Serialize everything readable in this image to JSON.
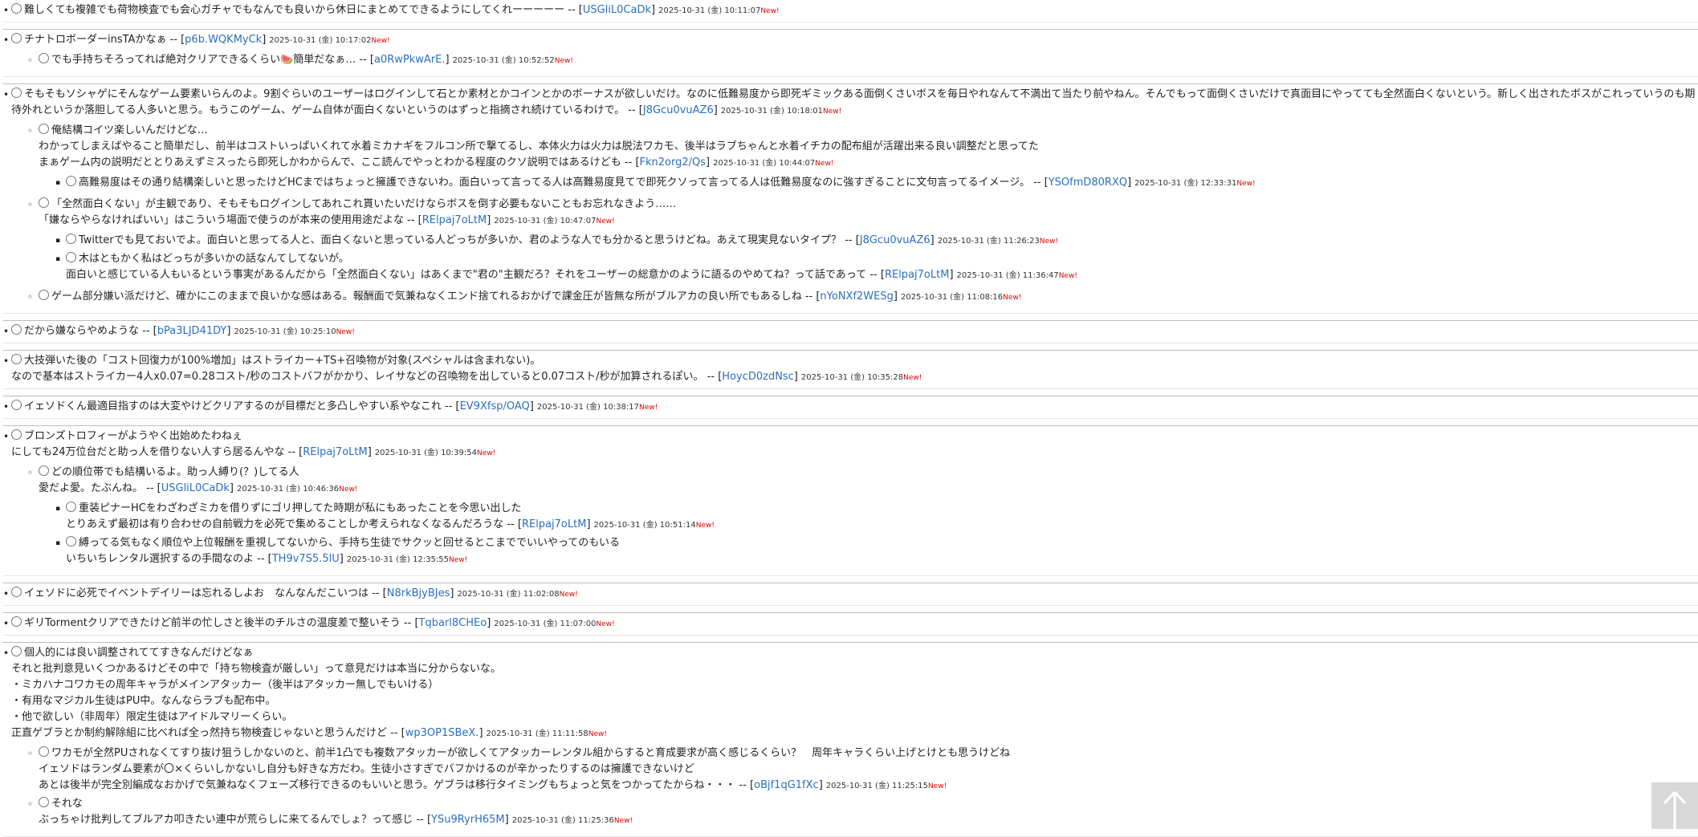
{
  "new_label": "New!",
  "posts": [
    {
      "text": "難しくても複雑でも荷物検査でも会心ガチャでもなんでも良いから休日にまとめてできるようにしてくれーーーーー",
      "id": "USGliL0CaDk",
      "date": "2025-10-31 (金) 10:11:07",
      "replies": []
    },
    {
      "text": "チナトロボーダーinsTAかなぁ",
      "id": "p6b.WQKMyCk",
      "date": "2025-10-31 (金) 10:17:02",
      "replies": [
        {
          "text": "でも手持ちそろってれば絶対クリアできるくらい🍉簡単だなぁ…",
          "id": "a0RwPkwArE.",
          "date": "2025-10-31 (金) 10:52:52",
          "replies": []
        }
      ]
    },
    {
      "text": "そもそもソシャゲにそんなゲーム要素いらんのよ。9割ぐらいのユーザーはログインして石とか素材とかコインとかのボーナスが欲しいだけ。なのに低難易度から即死ギミックある面倒くさいボスを毎日やれなんて不満出て当たり前やねん。そんでもって面倒くさいだけで真面目にやってても全然面白くないという。新しく出されたボスがこれっていうのも期待外れというか落胆してる人多いと思う。もうこのゲーム、ゲーム自体が面白くないというのはずっと指摘され続けているわけで。",
      "id": "J8Gcu0vuAZ6",
      "date": "2025-10-31 (金) 10:18:01",
      "replies": [
        {
          "text": "俺結構コイツ楽しいんだけどな…\nわかってしまえばやること簡単だし、前半はコストいっぱいくれて水着ミカナギをフルコン所で撃てるし、本体火力は火力は脱法ワカモ、後半はラブちゃんと水着イチカの配布組が活躍出来る良い調整だと思ってた\nまぁゲーム内の説明だととりあえずミスったら即死しかわからんで、ここ読んでやっとわかる程度のクソ説明ではあるけども",
          "id": "Fkn2org2/Qs",
          "date": "2025-10-31 (金) 10:44:07",
          "replies": [
            {
              "text": "高難易度はその通り結構楽しいと思ったけどHCまではちょっと擁護できないわ。面白いって言ってる人は高難易度見てで即死クソって言ってる人は低難易度なのに強すぎることに文句言ってるイメージ。",
              "id": "YSOfmD80RXQ",
              "date": "2025-10-31 (金) 12:33:31",
              "replies": []
            }
          ]
        },
        {
          "text": "「全然面白くない」が主観であり、そもそもログインしてあれこれ貰いたいだけならボスを倒す必要もないこともお忘れなきよう……\n「嫌ならやらなければいい」はこういう場面で使うのが本来の使用用途だよな",
          "id": "RElpaj7oLtM",
          "date": "2025-10-31 (金) 10:47:07",
          "replies": [
            {
              "text": "Twitterでも見ておいでよ。面白いと思ってる人と、面白くないと思っている人どっちが多いか、君のような人でも分かると思うけどね。あえて現実見ないタイプ？",
              "id": "J8Gcu0vuAZ6",
              "date": "2025-10-31 (金) 11:26:23",
              "replies": []
            },
            {
              "text": "木はともかく私はどっちが多いかの話なんてしてないが。\n面白いと感じている人もいるという事実があるんだから「全然面白くない」はあくまで\"君の\"主観だろ？それをユーザーの総意かのように語るのやめてね？って話であって",
              "id": "RElpaj7oLtM",
              "date": "2025-10-31 (金) 11:36:47",
              "replies": []
            }
          ]
        },
        {
          "text": "ゲーム部分嫌い派だけど、確かにこのままで良いかな感はある。報酬面で気兼ねなくエンド捨てれるおかげで課金圧が皆無な所がブルアカの良い所でもあるしね",
          "id": "nYoNXf2WESg",
          "date": "2025-10-31 (金) 11:08:16",
          "replies": []
        }
      ]
    },
    {
      "text": "だから嫌ならやめような",
      "id": "bPa3LJD41DY",
      "date": "2025-10-31 (金) 10:25:10",
      "replies": []
    },
    {
      "text": "大技弾いた後の「コスト回復力が100%増加」はストライカー+TS+召喚物が対象(スペシャルは含まれない)。\nなので基本はストライカー4人x0.07=0.28コスト/秒のコストバフがかかり、レイサなどの召喚物を出していると0.07コスト/秒が加算されるぽい。",
      "id": "HoycD0zdNsc",
      "date": "2025-10-31 (金) 10:35:28",
      "replies": []
    },
    {
      "text": "イェソドくん最適目指すのは大変やけどクリアするのが目標だと多凸しやすい系やなこれ",
      "id": "EV9Xfsp/OAQ",
      "date": "2025-10-31 (金) 10:38:17",
      "replies": []
    },
    {
      "text": "ブロンズトロフィーがようやく出始めたわねぇ\nにしても24万位台だと助っ人を借りない人すら居るんやな",
      "id": "RElpaj7oLtM",
      "date": "2025-10-31 (金) 10:39:54",
      "replies": [
        {
          "text": "どの順位帯でも結構いるよ。助っ人縛り(？)してる人\n愛だよ愛。たぶんね。",
          "id": "USGliL0CaDk",
          "date": "2025-10-31 (金) 10:46:36",
          "replies": [
            {
              "text": "重装ピナーHCをわざわざミカを借りずにゴリ押してた時期が私にもあったことを今思い出した\nとりあえず最初は有り合わせの自前戦力を必死で集めることしか考えられなくなるんだろうな",
              "id": "RElpaj7oLtM",
              "date": "2025-10-31 (金) 10:51:14",
              "replies": []
            },
            {
              "text": "縛ってる気もなく順位や上位報酬を重視してないから、手持ち生徒でサクッと回せるとこまででいいやってのもいる\nいちいちレンタル選択するの手間なのよ",
              "id": "TH9v7S5.5lU",
              "date": "2025-10-31 (金) 12:35:55",
              "replies": []
            }
          ]
        }
      ]
    },
    {
      "text": "イェソドに必死でイベントデイリーは忘れるしよお　なんなんだこいつは",
      "id": "N8rkBjyBJes",
      "date": "2025-10-31 (金) 11:02:08",
      "replies": []
    },
    {
      "text": "ギリTormentクリアできたけど前半の忙しさと後半のチルさの温度差で整いそう",
      "id": "Tqbarl8CHEo",
      "date": "2025-10-31 (金) 11:07:00",
      "replies": []
    },
    {
      "text": "個人的には良い調整されててすきなんだけどなぁ\nそれと批判意見いくつかあるけどその中で「持ち物検査が厳しい」って意見だけは本当に分からないな。\n・ミカハナコワカモの周年キャラがメインアタッカー（後半はアタッカー無しでもいける）\n・有用なマジカル生徒はPU中。なんならラブも配布中。\n・他で欲しい（非周年）限定生徒はアイドルマリーくらい。\n正直ゲブラとか制約解除組に比べれば全っ然持ち物検査じゃないと思うんだけど",
      "id": "wp3OP1SBeX.",
      "date": "2025-10-31 (金) 11:11:58",
      "replies": [
        {
          "text": "ワカモが全然PUされなくてすり抜け狙うしかないのと、前半1凸でも複数アタッカーが欲しくてアタッカーレンタル組からすると育成要求が高く感じるくらい？　周年キャラくらい上げとけとも思うけどね\nイェソドはランダム要素が〇×くらいしかないし自分も好きな方だわ。生徒小さすぎでバフかけるのが辛かったりするのは擁護できないけど\nあとは後半が完全別編成なおかげで気兼ねなくフェーズ移行できるのもいいと思う。ゲブラは移行タイミングもちょっと気をつかってたからね・・・",
          "id": "oBjf1qG1fXc",
          "date": "2025-10-31 (金) 11:25:15",
          "replies": []
        },
        {
          "text": "それな\nぶっちゃけ批判してブルアカ叩きたい連中が荒らしに来てるんでしょ？って感じ",
          "id": "YSu9RyrH65M",
          "date": "2025-10-31 (金) 11:25:36",
          "replies": []
        }
      ]
    }
  ]
}
